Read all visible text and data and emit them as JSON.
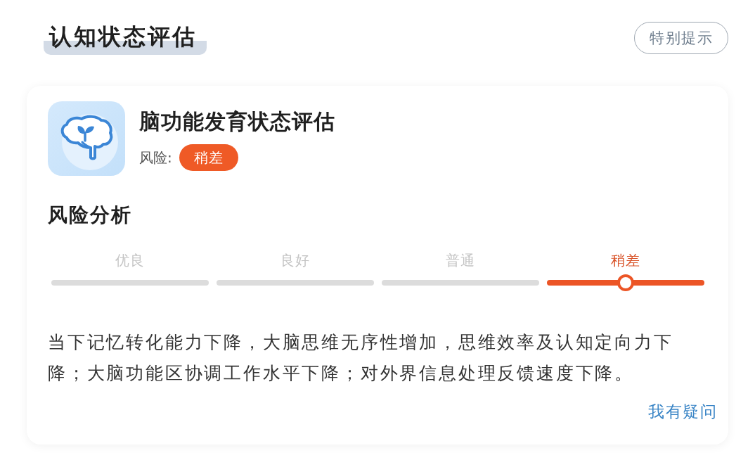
{
  "header": {
    "title": "认知状态评估",
    "button": "特别提示"
  },
  "assessment": {
    "title": "脑功能发育状态评估",
    "risk_label": "风险:",
    "risk_badge": "稍差"
  },
  "analysis": {
    "title": "风险分析",
    "levels": [
      {
        "label": "优良",
        "selected": false
      },
      {
        "label": "良好",
        "selected": false
      },
      {
        "label": "普通",
        "selected": false
      },
      {
        "label": "稍差",
        "selected": true
      }
    ],
    "description": "当下记忆转化能力下降，大脑思维无序性增加，思维效率及认知定向力下降；大脑功能区协调工作水平下降；对外界信息处理反馈速度下降。",
    "link": "我有疑问"
  }
}
